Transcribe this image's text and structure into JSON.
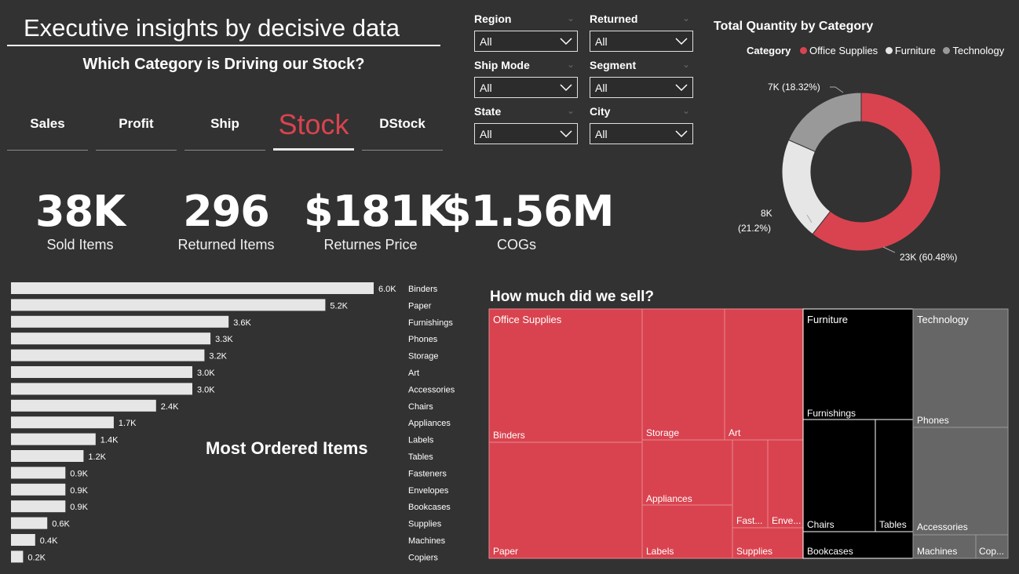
{
  "header": {
    "title": "Executive insights by decisive data",
    "subtitle": "Which Category is Driving our Stock?"
  },
  "tabs": [
    {
      "label": "Sales",
      "active": false
    },
    {
      "label": "Profit",
      "active": false
    },
    {
      "label": "Ship",
      "active": false
    },
    {
      "label": "Stock",
      "active": true
    },
    {
      "label": "DStock",
      "active": false
    }
  ],
  "kpis": [
    {
      "value": "38K",
      "label": "Sold Items"
    },
    {
      "value": "296",
      "label": "Returned Items"
    },
    {
      "value": "$181K",
      "label": "Returnes Price"
    },
    {
      "value": "$1.56M",
      "label": "COGs"
    }
  ],
  "slicers": [
    {
      "label": "Region",
      "value": "All"
    },
    {
      "label": "Returned",
      "value": "All"
    },
    {
      "label": "Ship Mode",
      "value": "All"
    },
    {
      "label": "Segment",
      "value": "All"
    },
    {
      "label": "State",
      "value": "All"
    },
    {
      "label": "City",
      "value": "All"
    }
  ],
  "colors": {
    "office_supplies": "#d9434f",
    "furniture": "#e6e6e6",
    "technology": "#999999",
    "bar": "#e6e6e6",
    "treemap_furniture": "#000000",
    "treemap_technology": "#666666"
  },
  "chart_data": [
    {
      "type": "pie",
      "title": "Total Quantity by Category",
      "legend_title": "Category",
      "legend_position": "top",
      "categories": [
        "Office Supplies",
        "Furniture",
        "Technology"
      ],
      "values": [
        23000,
        8000,
        7000
      ],
      "percent": [
        60.48,
        21.2,
        18.32
      ],
      "data_labels": [
        "23K (60.48%)",
        "8K",
        "(21.2%)",
        "7K (18.32%)"
      ]
    },
    {
      "type": "bar",
      "title": "Most Ordered Items",
      "orientation": "horizontal",
      "categories": [
        "Binders",
        "Paper",
        "Furnishings",
        "Phones",
        "Storage",
        "Art",
        "Accessories",
        "Chairs",
        "Appliances",
        "Labels",
        "Tables",
        "Fasteners",
        "Envelopes",
        "Bookcases",
        "Supplies",
        "Machines",
        "Copiers"
      ],
      "values": [
        6000,
        5200,
        3600,
        3300,
        3200,
        3000,
        3000,
        2400,
        1700,
        1400,
        1200,
        900,
        900,
        900,
        600,
        400,
        200
      ],
      "data_labels": [
        "6.0K",
        "5.2K",
        "3.6K",
        "3.3K",
        "3.2K",
        "3.0K",
        "3.0K",
        "2.4K",
        "1.7K",
        "1.4K",
        "1.2K",
        "0.9K",
        "0.9K",
        "0.9K",
        "0.6K",
        "0.4K",
        "0.2K"
      ],
      "xlim": [
        0,
        6000
      ]
    },
    {
      "type": "treemap",
      "title": "How much did we sell?",
      "groups": [
        {
          "name": "Office Supplies",
          "items": [
            "Binders",
            "Paper",
            "Storage",
            "Art",
            "Appliances",
            "Labels",
            "Fast...",
            "Enve...",
            "Supplies"
          ]
        },
        {
          "name": "Furniture",
          "items": [
            "Furnishings",
            "Chairs",
            "Tables",
            "Bookcases"
          ]
        },
        {
          "name": "Technology",
          "items": [
            "Phones",
            "Accessories",
            "Machines",
            "Cop..."
          ]
        }
      ]
    }
  ]
}
